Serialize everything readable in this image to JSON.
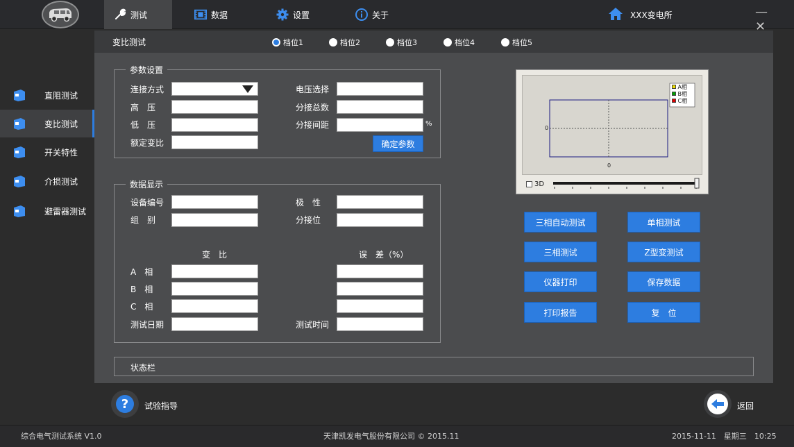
{
  "topbar": {
    "tabs": [
      {
        "label": "测试",
        "icon": "wrench-icon"
      },
      {
        "label": "数据",
        "icon": "film-icon"
      },
      {
        "label": "设置",
        "icon": "gear-icon"
      },
      {
        "label": "关于",
        "icon": "info-icon"
      }
    ],
    "station": "XXX变电所",
    "window_controls": "— ✕"
  },
  "page_title": "变比测试",
  "gears": [
    {
      "label": "档位1",
      "selected": true
    },
    {
      "label": "档位2",
      "selected": false
    },
    {
      "label": "档位3",
      "selected": false
    },
    {
      "label": "档位4",
      "selected": false
    },
    {
      "label": "档位5",
      "selected": false
    }
  ],
  "sidebar": {
    "items": [
      {
        "label": "直阻测试"
      },
      {
        "label": "变比测试",
        "active": true
      },
      {
        "label": "开关特性"
      },
      {
        "label": "介损测试"
      },
      {
        "label": "避雷器测试"
      }
    ]
  },
  "params": {
    "legend": "参数设置",
    "connection_label": "连接方式",
    "high_label": "高　压",
    "low_label": "低　压",
    "rated_label": "额定变比",
    "voltage_label": "电压选择",
    "total_taps_label": "分接总数",
    "tap_spacing_label": "分接间距",
    "percent": "%",
    "confirm_button": "确定参数",
    "values": {
      "connection": "",
      "high": "",
      "low": "",
      "rated": "",
      "voltage": "",
      "total_taps": "",
      "tap_spacing": ""
    }
  },
  "display": {
    "legend": "数据显示",
    "device_no_label": "设备编号",
    "group_label": "组　别",
    "polarity_label": "极　性",
    "tap_label": "分接位",
    "ratio_header": "变　比",
    "error_header": "误　差（%）",
    "phase_a_label": "A　相",
    "phase_b_label": "B　相",
    "phase_c_label": "C　相",
    "date_label": "测试日期",
    "time_label": "测试时间"
  },
  "chart": {
    "legend": [
      "A相",
      "B相",
      "C相"
    ],
    "legend_colors": [
      "#f0e000",
      "#00a000",
      "#e00000"
    ],
    "y_tick": "0",
    "x_tick": "0",
    "checkbox_label": "3D"
  },
  "buttons": {
    "auto_three": "三相自动测试",
    "single": "单相测试",
    "three": "三相测试",
    "z_type": "Z型变测试",
    "print_inst": "仪器打印",
    "save": "保存数据",
    "print_report": "打印报告",
    "reset": "复　位"
  },
  "status_label": "状态栏",
  "guide_label": "试验指导",
  "back_label": "返回",
  "footer": {
    "app_name": "综合电气测试系统 V1.0",
    "copyright": "天津凯发电气股份有限公司 © 2015.11",
    "datetime": "2015-11-11　星期三　10:25"
  }
}
